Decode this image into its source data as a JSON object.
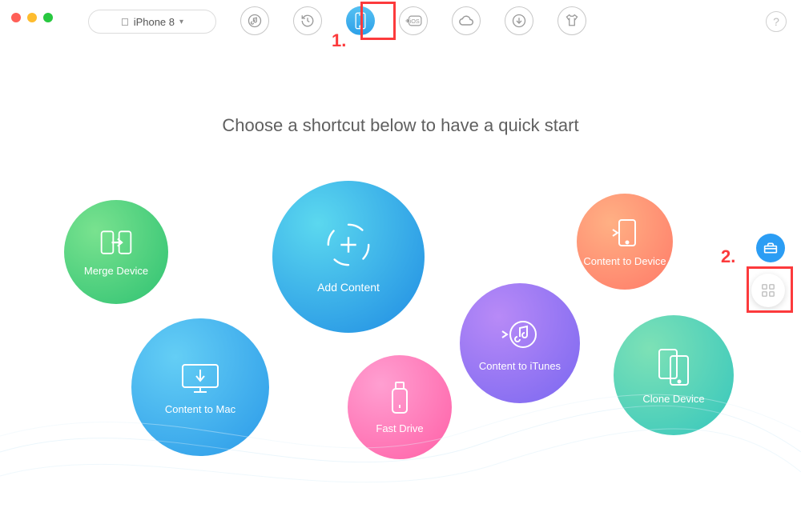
{
  "titlebar": {
    "device_label": "iPhone 8"
  },
  "toolbar": {
    "items": [
      {
        "name": "music-library-icon"
      },
      {
        "name": "history-icon"
      },
      {
        "name": "device-icon",
        "active": true
      },
      {
        "name": "to-ios-icon"
      },
      {
        "name": "icloud-icon"
      },
      {
        "name": "download-icon"
      },
      {
        "name": "skin-icon"
      }
    ],
    "help_label": "?"
  },
  "heading": "Choose a shortcut below to have a quick start",
  "shortcuts": {
    "merge_device": {
      "label": "Merge Device"
    },
    "add_content": {
      "label": "Add Content"
    },
    "content_to_device": {
      "label": "Content to Device"
    },
    "content_to_mac": {
      "label": "Content to Mac"
    },
    "content_to_itunes": {
      "label": "Content to iTunes"
    },
    "fast_drive": {
      "label": "Fast Drive"
    },
    "clone_device": {
      "label": "Clone Device"
    }
  },
  "side": {
    "toolbox_name": "toolbox-button",
    "grid_name": "category-grid-button"
  },
  "annotations": {
    "step1": "1.",
    "step2": "2."
  }
}
